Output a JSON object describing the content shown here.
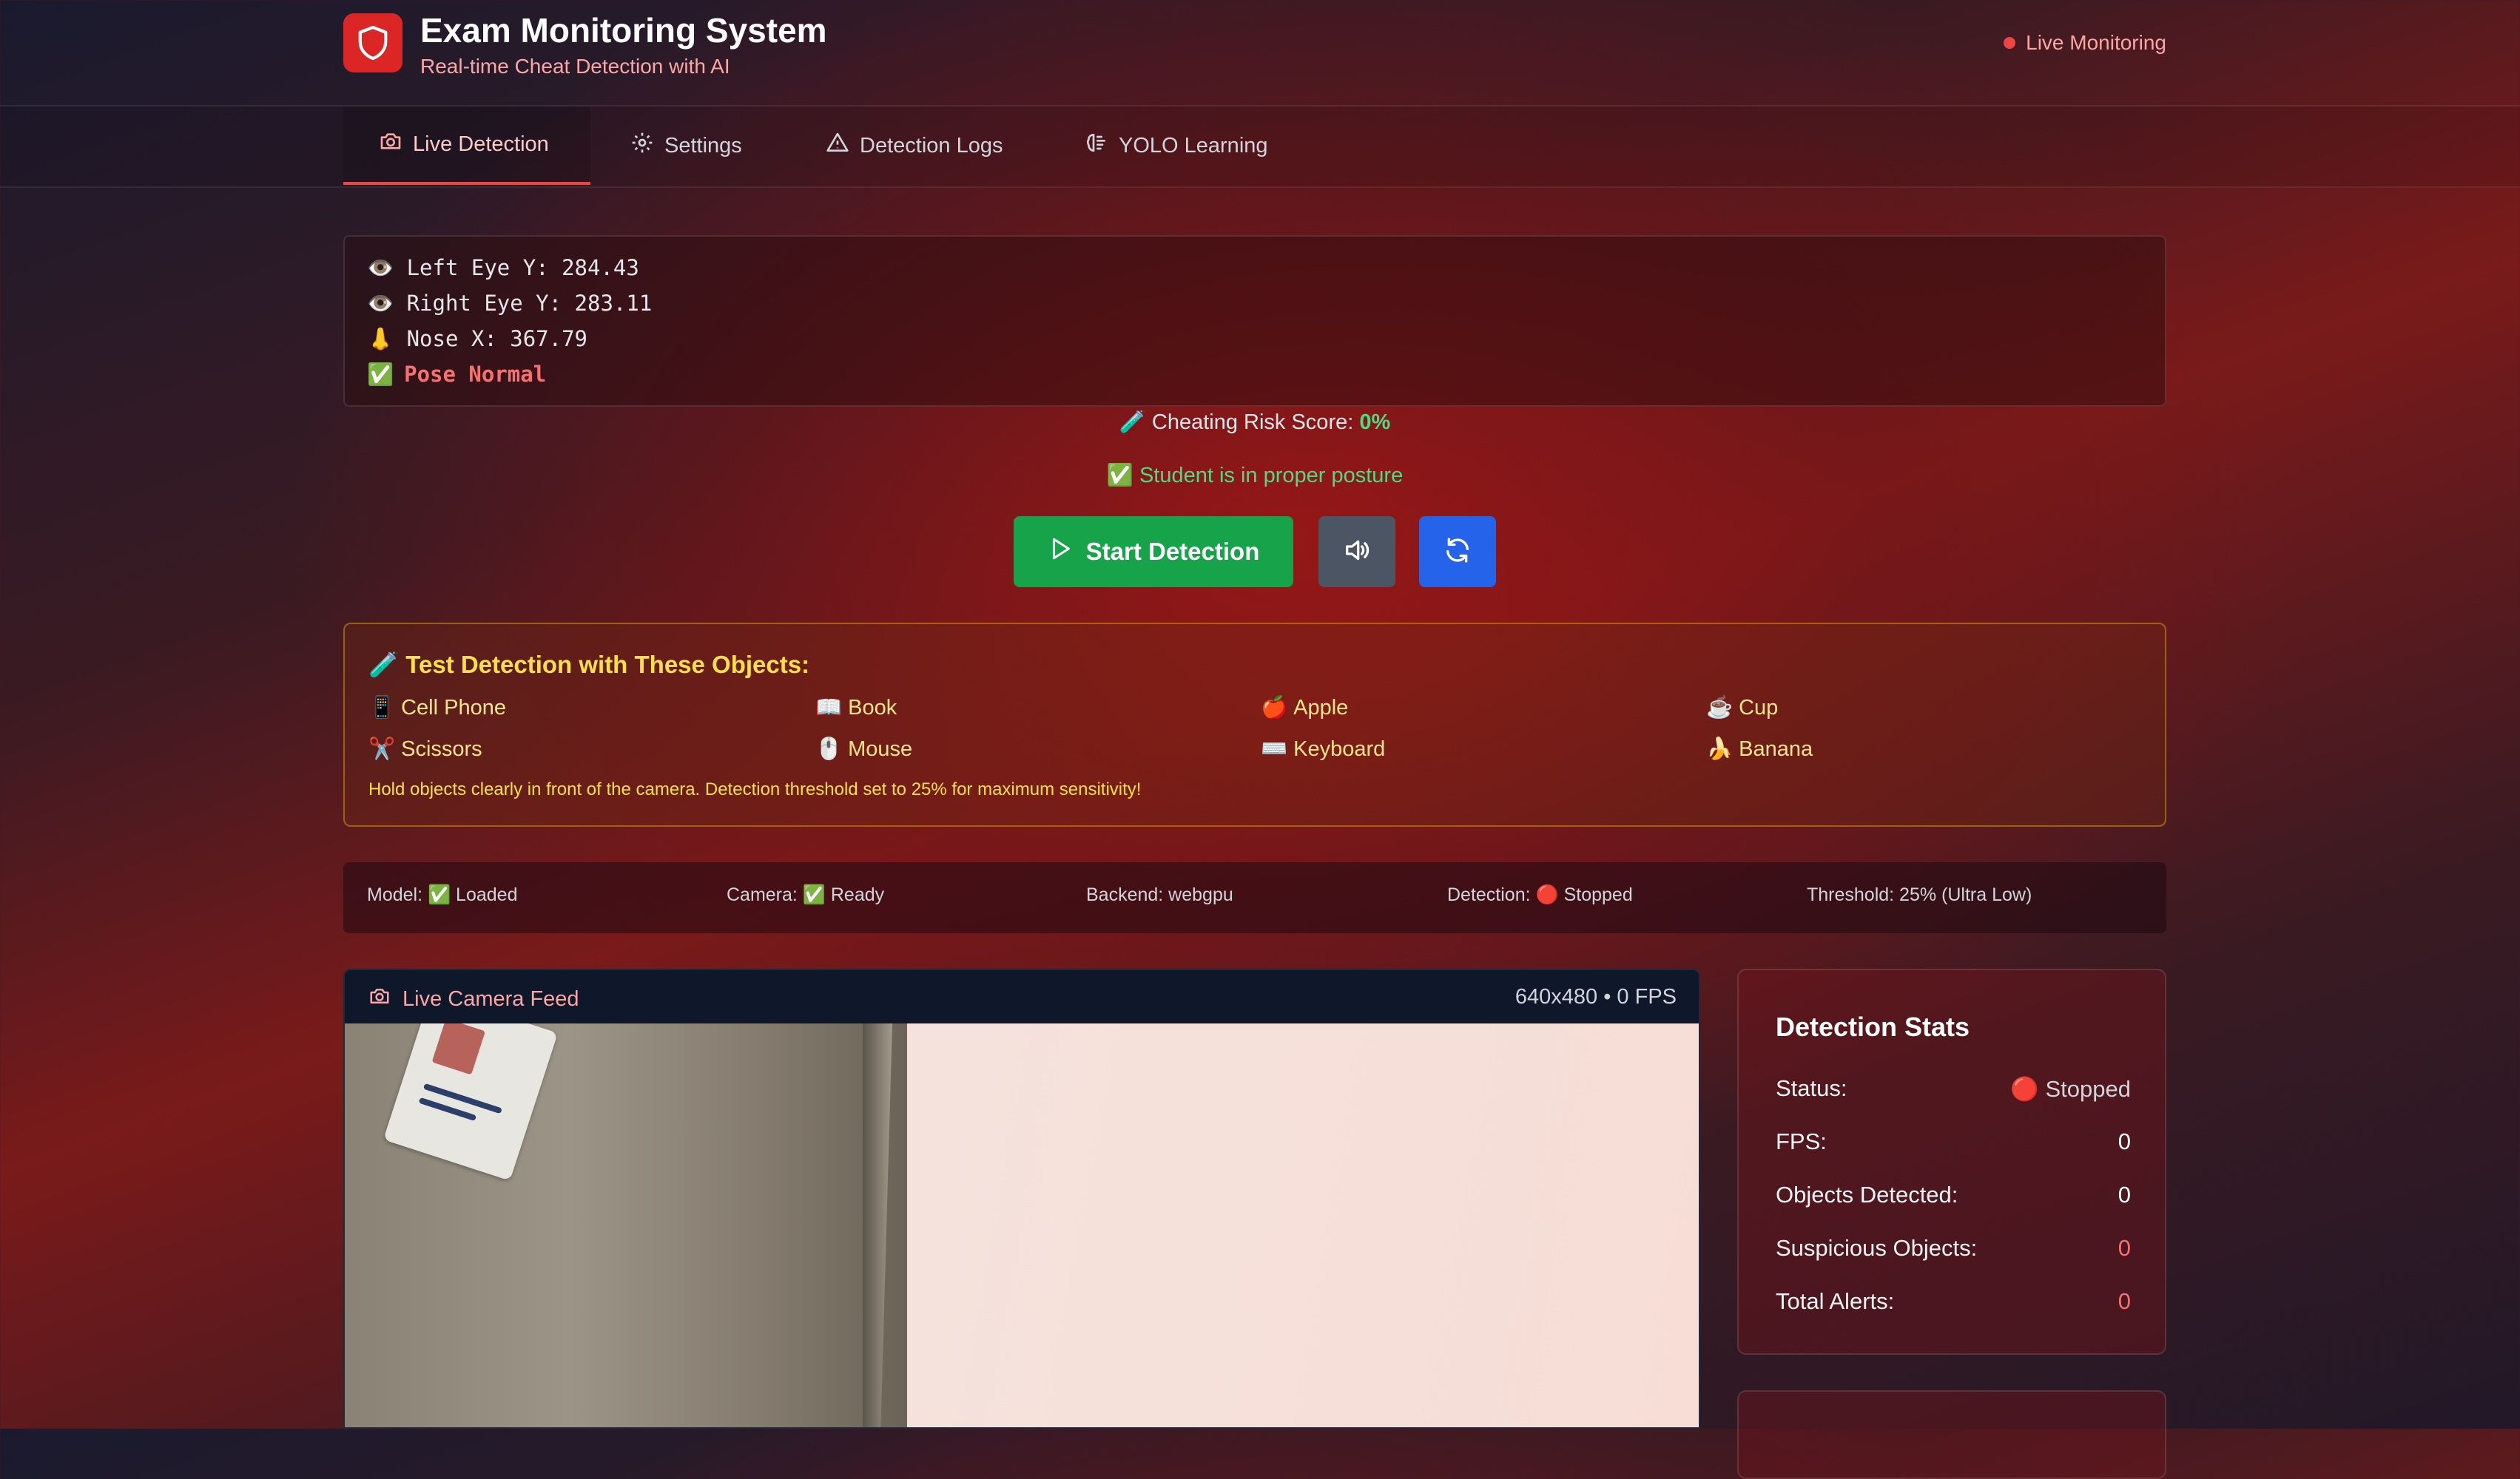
{
  "header": {
    "title": "Exam Monitoring System",
    "subtitle": "Real-time Cheat Detection with AI",
    "live_label": "Live Monitoring",
    "logo_icon": "shield-icon"
  },
  "tabs": [
    {
      "label": "Live Detection",
      "icon": "camera-icon",
      "active": true
    },
    {
      "label": "Settings",
      "icon": "gear-icon",
      "active": false
    },
    {
      "label": "Detection Logs",
      "icon": "warning-icon",
      "active": false
    },
    {
      "label": "YOLO Learning",
      "icon": "brain-icon",
      "active": false
    }
  ],
  "pose": {
    "left_eye": "👁️ Left Eye Y: 284.43",
    "right_eye": "👁️ Right Eye Y: 283.11",
    "nose": "👃 Nose X: 367.79",
    "status_icon": "✅",
    "status": "Pose Normal"
  },
  "risk": {
    "label": "🧪 Cheating Risk Score:",
    "value": "0%"
  },
  "posture_message": "✅ Student is in proper posture",
  "controls": {
    "start_label": "Start Detection",
    "sound_icon": "speaker-icon",
    "refresh_icon": "refresh-icon"
  },
  "test_objects": {
    "title": "🧪 Test Detection with These Objects:",
    "items": [
      {
        "emoji": "📱",
        "label": "Cell Phone"
      },
      {
        "emoji": "📖",
        "label": "Book"
      },
      {
        "emoji": "🍎",
        "label": "Apple"
      },
      {
        "emoji": "☕",
        "label": "Cup"
      },
      {
        "emoji": "✂️",
        "label": "Scissors"
      },
      {
        "emoji": "🖱️",
        "label": "Mouse"
      },
      {
        "emoji": "⌨️",
        "label": "Keyboard"
      },
      {
        "emoji": "🍌",
        "label": "Banana"
      }
    ],
    "note": "Hold objects clearly in front of the camera. Detection threshold set to 25% for maximum sensitivity!"
  },
  "system_status": {
    "model": "Model: ✅ Loaded",
    "camera": "Camera: ✅ Ready",
    "backend": "Backend: webgpu",
    "detection": "Detection: 🔴 Stopped",
    "threshold": "Threshold: 25% (Ultra Low)"
  },
  "camera_feed": {
    "title": "Live Camera Feed",
    "info": "640x480 • 0 FPS"
  },
  "stats": {
    "title": "Detection Stats",
    "rows": [
      {
        "label": "Status:",
        "value": "🔴 Stopped"
      },
      {
        "label": "FPS:",
        "value": "0"
      },
      {
        "label": "Objects Detected:",
        "value": "0"
      },
      {
        "label": "Suspicious Objects:",
        "value": "0"
      },
      {
        "label": "Total Alerts:",
        "value": "0"
      }
    ]
  },
  "colors": {
    "accent_red": "#ef4444",
    "start_green": "#16a34a",
    "refresh_blue": "#2563eb",
    "sound_gray": "#4b5563",
    "warning_yellow": "#fde047"
  }
}
